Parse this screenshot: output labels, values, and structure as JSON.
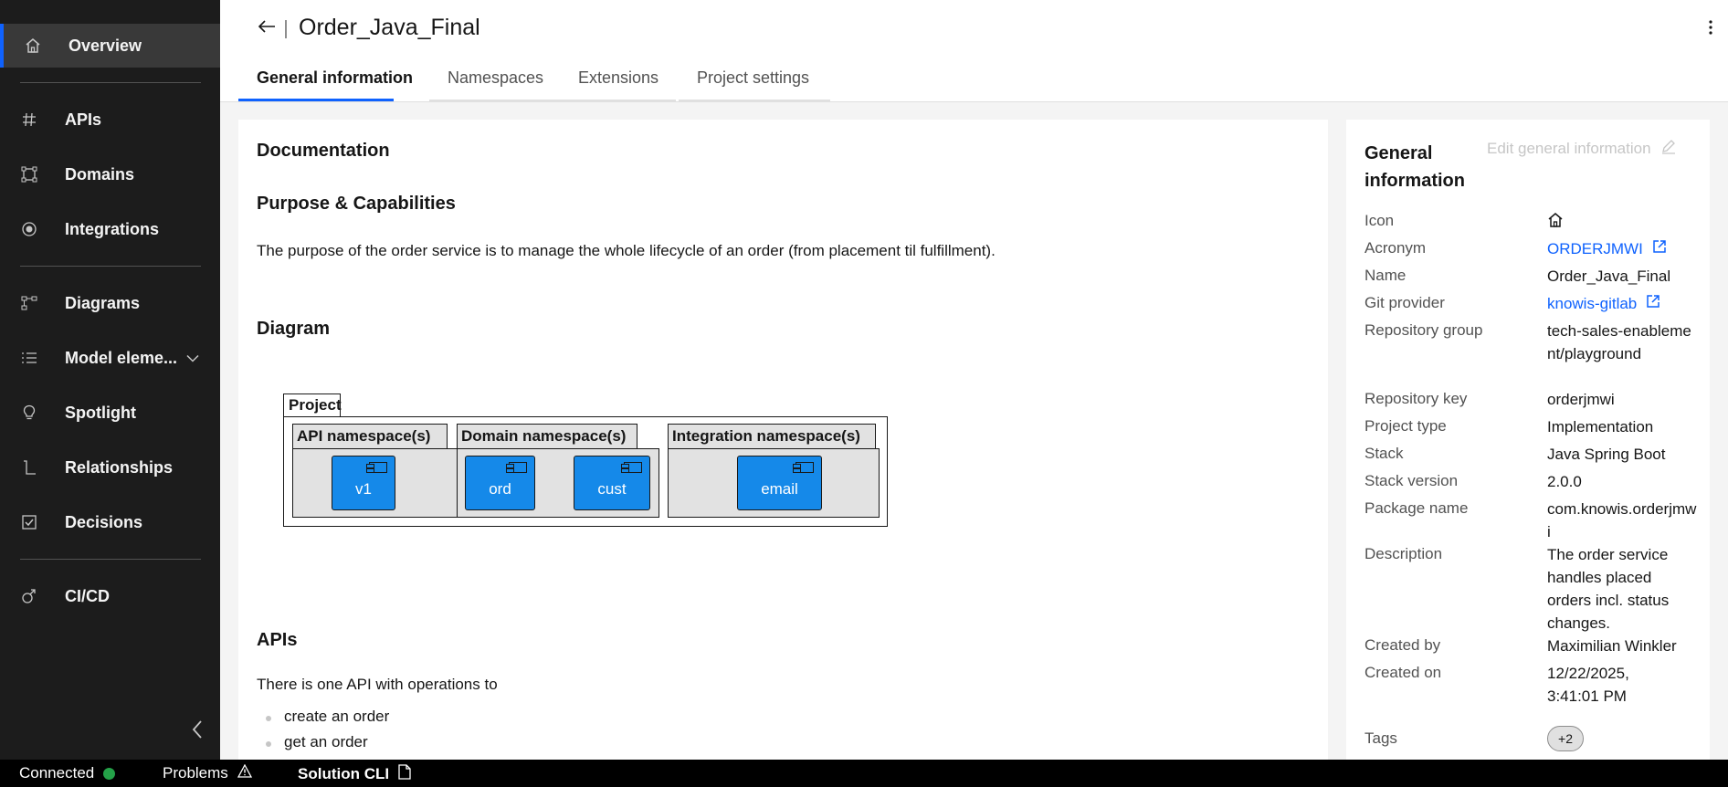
{
  "app": {
    "title": "Order_Java_Final"
  },
  "sidebar": {
    "items": [
      {
        "label": "Overview",
        "icon": "home-icon"
      },
      {
        "label": "APIs",
        "icon": "hashtag-icon"
      },
      {
        "label": "Domains",
        "icon": "domain-icon"
      },
      {
        "label": "Integrations",
        "icon": "integration-icon"
      },
      {
        "label": "Diagrams",
        "icon": "diagram-icon"
      },
      {
        "label": "Model eleme...",
        "icon": "list-icon"
      },
      {
        "label": "Spotlight",
        "icon": "lightbulb-icon"
      },
      {
        "label": "Relationships",
        "icon": "relationship-icon"
      },
      {
        "label": "Decisions",
        "icon": "checkbox-icon"
      },
      {
        "label": "CI/CD",
        "icon": "cicd-icon"
      }
    ]
  },
  "tabs": [
    {
      "label": "General information",
      "active": true
    },
    {
      "label": "Namespaces",
      "active": false
    },
    {
      "label": "Extensions",
      "active": false
    },
    {
      "label": "Project settings",
      "active": false
    }
  ],
  "main": {
    "documentation_heading": "Documentation",
    "purpose_heading": "Purpose & Capabilities",
    "purpose_text": "The purpose of the order service is to manage the whole lifecycle of an order (from placement til fulfillment).",
    "diagram_heading": "Diagram",
    "apis_heading": "APIs",
    "apis_text": "There is one API with operations to",
    "apis_bullets": [
      "create an order",
      "get an order"
    ]
  },
  "diagram": {
    "project_label": "Project",
    "api_ns_label": "API namespace(s)",
    "domain_ns_label": "Domain namespace(s)",
    "integration_ns_label": "Integration namespace(s)",
    "components": {
      "v1": "v1",
      "ord": "ord",
      "cust": "cust",
      "email": "email"
    }
  },
  "panel": {
    "title": "General information",
    "edit_label": "Edit general information",
    "labels": {
      "icon": "Icon",
      "acronym": "Acronym",
      "name": "Name",
      "git_provider": "Git provider",
      "repository_group": "Repository group",
      "repository_key": "Repository key",
      "project_type": "Project type",
      "stack": "Stack",
      "stack_version": "Stack version",
      "package_name": "Package name",
      "description": "Description",
      "created_by": "Created by",
      "created_on": "Created on",
      "tags": "Tags"
    },
    "values": {
      "icon": "home-icon",
      "acronym": "ORDERJMWI",
      "name": "Order_Java_Final",
      "git_provider": "knowis-gitlab",
      "repository_group": "tech-sales-enablement/playground",
      "repository_key": "orderjmwi",
      "project_type": "Implementation",
      "stack": "Java Spring Boot",
      "stack_version": "2.0.0",
      "package_name": "com.knowis.orderjmwi",
      "description": "The order service handles placed orders incl. status changes.",
      "created_by": "Maximilian Winkler",
      "created_on": "12/22/2025, 3:41:01 PM",
      "tags_more": "+2"
    }
  },
  "statusbar": {
    "connected": "Connected",
    "problems": "Problems",
    "cli": "Solution CLI"
  },
  "colors": {
    "accent": "#0f62fe",
    "sidebar_bg": "#1c1c1c",
    "component_blue": "#1589e9",
    "connected_green": "#24a148"
  }
}
